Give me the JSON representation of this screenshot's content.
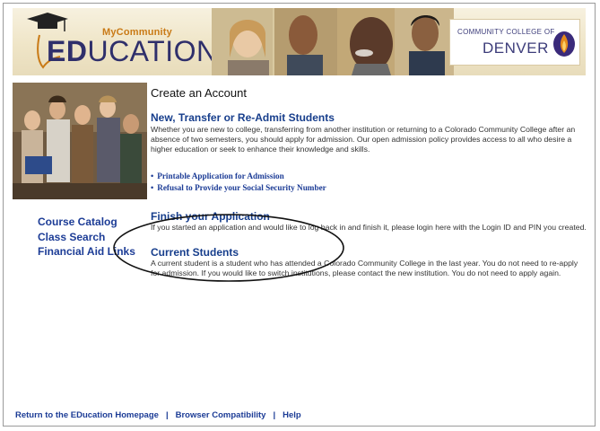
{
  "header": {
    "brand_my": "MyCommunity",
    "brand_ed_bold": "ED",
    "brand_ed_rest": "UCATION",
    "college_top": "COMMUNITY COLLEGE OF",
    "college_name": "DENVER"
  },
  "main": {
    "title": "Create an Account",
    "section1": {
      "heading": "New, Transfer or Re-Admit Students",
      "body": "Whether you are new to college, transferring from another institution or returning to a Colorado Community College after an absence of two semesters, you should apply for admission. Our open admission policy provides access to all who desire a higher education or seek to enhance their knowledge and skills.",
      "links": [
        "Printable Application for Admission",
        "Refusal to Provide your Social Security Number"
      ]
    },
    "section2": {
      "heading": "Finish your Application",
      "body": "If you started an application and would like to log back in and finish it, please login here with the Login ID and PIN you created."
    },
    "section3": {
      "heading": "Current Students",
      "body": "A current student is a student who has attended a Colorado Community College in the last year. You do not need to re-apply for admission. If you would like to switch institutions, please contact the new institution. You do not need to apply again."
    }
  },
  "sidebar": {
    "links": [
      "Course Catalog",
      "Class Search",
      "Financial Aid Links"
    ]
  },
  "footer": {
    "links": [
      "Return to the EDucation Homepage",
      "Browser Compatibility",
      "Help"
    ],
    "separator": "|"
  },
  "colors": {
    "link": "#1c3c96",
    "heading": "#173e8c",
    "header_bg": "#efe5c7",
    "brand_navy": "#2f2f6b",
    "brand_gold": "#c97a16"
  }
}
